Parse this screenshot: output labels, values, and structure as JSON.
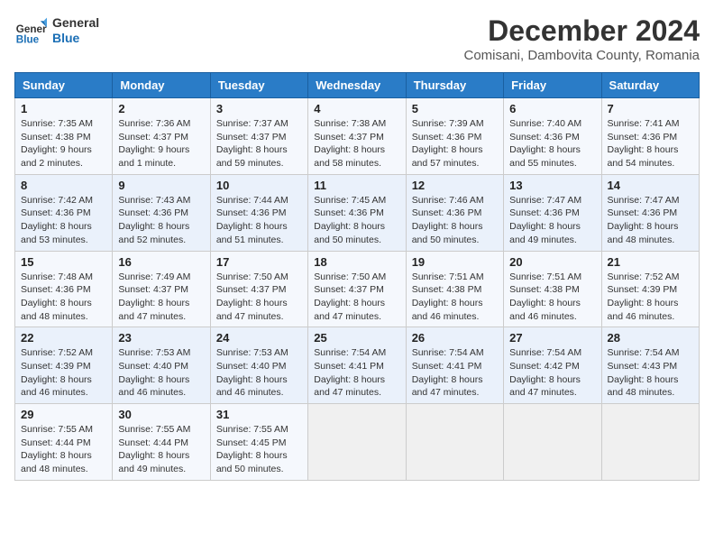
{
  "header": {
    "logo_line1": "General",
    "logo_line2": "Blue",
    "title": "December 2024",
    "subtitle": "Comisani, Dambovita County, Romania"
  },
  "calendar": {
    "columns": [
      "Sunday",
      "Monday",
      "Tuesday",
      "Wednesday",
      "Thursday",
      "Friday",
      "Saturday"
    ],
    "weeks": [
      [
        {
          "day": "1",
          "sunrise": "7:35 AM",
          "sunset": "4:38 PM",
          "daylight": "9 hours and 2 minutes."
        },
        {
          "day": "2",
          "sunrise": "7:36 AM",
          "sunset": "4:37 PM",
          "daylight": "9 hours and 1 minute."
        },
        {
          "day": "3",
          "sunrise": "7:37 AM",
          "sunset": "4:37 PM",
          "daylight": "8 hours and 59 minutes."
        },
        {
          "day": "4",
          "sunrise": "7:38 AM",
          "sunset": "4:37 PM",
          "daylight": "8 hours and 58 minutes."
        },
        {
          "day": "5",
          "sunrise": "7:39 AM",
          "sunset": "4:36 PM",
          "daylight": "8 hours and 57 minutes."
        },
        {
          "day": "6",
          "sunrise": "7:40 AM",
          "sunset": "4:36 PM",
          "daylight": "8 hours and 55 minutes."
        },
        {
          "day": "7",
          "sunrise": "7:41 AM",
          "sunset": "4:36 PM",
          "daylight": "8 hours and 54 minutes."
        }
      ],
      [
        {
          "day": "8",
          "sunrise": "7:42 AM",
          "sunset": "4:36 PM",
          "daylight": "8 hours and 53 minutes."
        },
        {
          "day": "9",
          "sunrise": "7:43 AM",
          "sunset": "4:36 PM",
          "daylight": "8 hours and 52 minutes."
        },
        {
          "day": "10",
          "sunrise": "7:44 AM",
          "sunset": "4:36 PM",
          "daylight": "8 hours and 51 minutes."
        },
        {
          "day": "11",
          "sunrise": "7:45 AM",
          "sunset": "4:36 PM",
          "daylight": "8 hours and 50 minutes."
        },
        {
          "day": "12",
          "sunrise": "7:46 AM",
          "sunset": "4:36 PM",
          "daylight": "8 hours and 50 minutes."
        },
        {
          "day": "13",
          "sunrise": "7:47 AM",
          "sunset": "4:36 PM",
          "daylight": "8 hours and 49 minutes."
        },
        {
          "day": "14",
          "sunrise": "7:47 AM",
          "sunset": "4:36 PM",
          "daylight": "8 hours and 48 minutes."
        }
      ],
      [
        {
          "day": "15",
          "sunrise": "7:48 AM",
          "sunset": "4:36 PM",
          "daylight": "8 hours and 48 minutes."
        },
        {
          "day": "16",
          "sunrise": "7:49 AM",
          "sunset": "4:37 PM",
          "daylight": "8 hours and 47 minutes."
        },
        {
          "day": "17",
          "sunrise": "7:50 AM",
          "sunset": "4:37 PM",
          "daylight": "8 hours and 47 minutes."
        },
        {
          "day": "18",
          "sunrise": "7:50 AM",
          "sunset": "4:37 PM",
          "daylight": "8 hours and 47 minutes."
        },
        {
          "day": "19",
          "sunrise": "7:51 AM",
          "sunset": "4:38 PM",
          "daylight": "8 hours and 46 minutes."
        },
        {
          "day": "20",
          "sunrise": "7:51 AM",
          "sunset": "4:38 PM",
          "daylight": "8 hours and 46 minutes."
        },
        {
          "day": "21",
          "sunrise": "7:52 AM",
          "sunset": "4:39 PM",
          "daylight": "8 hours and 46 minutes."
        }
      ],
      [
        {
          "day": "22",
          "sunrise": "7:52 AM",
          "sunset": "4:39 PM",
          "daylight": "8 hours and 46 minutes."
        },
        {
          "day": "23",
          "sunrise": "7:53 AM",
          "sunset": "4:40 PM",
          "daylight": "8 hours and 46 minutes."
        },
        {
          "day": "24",
          "sunrise": "7:53 AM",
          "sunset": "4:40 PM",
          "daylight": "8 hours and 46 minutes."
        },
        {
          "day": "25",
          "sunrise": "7:54 AM",
          "sunset": "4:41 PM",
          "daylight": "8 hours and 47 minutes."
        },
        {
          "day": "26",
          "sunrise": "7:54 AM",
          "sunset": "4:41 PM",
          "daylight": "8 hours and 47 minutes."
        },
        {
          "day": "27",
          "sunrise": "7:54 AM",
          "sunset": "4:42 PM",
          "daylight": "8 hours and 47 minutes."
        },
        {
          "day": "28",
          "sunrise": "7:54 AM",
          "sunset": "4:43 PM",
          "daylight": "8 hours and 48 minutes."
        }
      ],
      [
        {
          "day": "29",
          "sunrise": "7:55 AM",
          "sunset": "4:44 PM",
          "daylight": "8 hours and 48 minutes."
        },
        {
          "day": "30",
          "sunrise": "7:55 AM",
          "sunset": "4:44 PM",
          "daylight": "8 hours and 49 minutes."
        },
        {
          "day": "31",
          "sunrise": "7:55 AM",
          "sunset": "4:45 PM",
          "daylight": "8 hours and 50 minutes."
        },
        null,
        null,
        null,
        null
      ]
    ]
  }
}
